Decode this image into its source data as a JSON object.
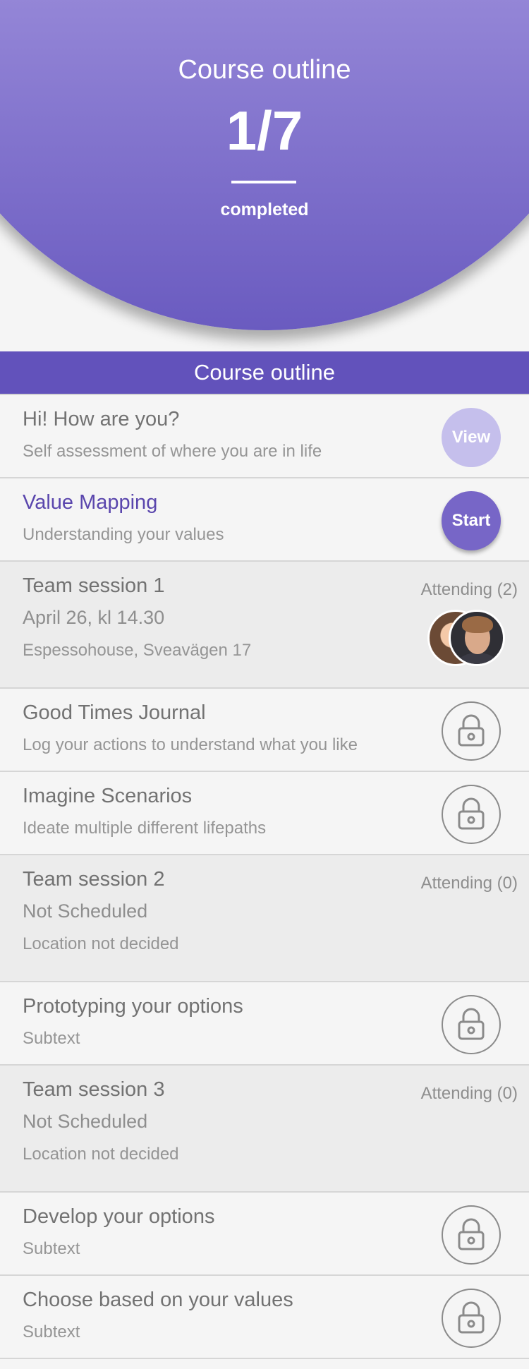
{
  "hero": {
    "title": "Course outline",
    "progress": "1/7",
    "status": "completed"
  },
  "section": {
    "title": "Course outline"
  },
  "items": [
    {
      "title": "Hi! How are you?",
      "subtitle": "Self assessment of where you are in life",
      "action": "View"
    },
    {
      "title": "Value Mapping",
      "subtitle": "Understanding your values",
      "action": "Start"
    },
    {
      "title": "Team session 1",
      "date": "April 26, kl 14.30",
      "location": "Espessohouse, Sveavägen 17",
      "attending": "Attending (2)"
    },
    {
      "title": "Good Times Journal",
      "subtitle": "Log your actions to understand what you like",
      "icon": "lock-icon"
    },
    {
      "title": "Imagine Scenarios",
      "subtitle": "Ideate multiple different lifepaths",
      "icon": "lock-icon"
    },
    {
      "title": "Team session 2",
      "date": "Not Scheduled",
      "location": "Location not decided",
      "attending": "Attending (0)"
    },
    {
      "title": "Prototyping your options",
      "subtitle": "Subtext",
      "icon": "lock-icon"
    },
    {
      "title": "Team session 3",
      "date": "Not Scheduled",
      "location": "Location not decided",
      "attending": "Attending (0)"
    },
    {
      "title": "Develop your options",
      "subtitle": "Subtext",
      "icon": "lock-icon"
    },
    {
      "title": "Choose based on your values",
      "subtitle": "Subtext",
      "icon": "lock-icon"
    }
  ],
  "colors": {
    "primary": "#6252bb",
    "accent_light": "#c5bfec",
    "active_title": "#5a46ad"
  }
}
